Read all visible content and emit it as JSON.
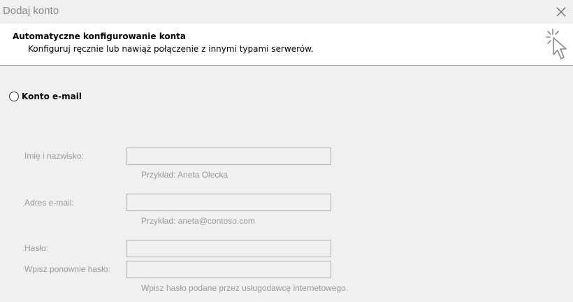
{
  "window": {
    "title": "Dodaj konto"
  },
  "header": {
    "title": "Automatyczne konfigurowanie konta",
    "subtitle": "Konfiguruj ręcznie lub nawiąż połączenie z innymi typami serwerów."
  },
  "email_account": {
    "radio_label": "Konto e-mail",
    "selected": false
  },
  "form": {
    "name_label": "Imię i nazwisko:",
    "name_value": "",
    "name_hint": "Przykład: Aneta Olecka",
    "email_label": "Adres e-mail:",
    "email_value": "",
    "email_hint": "Przykład: aneta@contoso.com",
    "password_label": "Hasło:",
    "password_value": "",
    "confirm_label": "Wpisz ponownie hasło:",
    "confirm_value": "",
    "password_hint": "Wpisz hasło podane przez usługodawcę internetowego."
  },
  "icons": {
    "close": "close-icon",
    "wizard": "cursor-sparkle-icon"
  },
  "colors": {
    "background": "#f0f0f0",
    "header_background": "#ffffff",
    "disabled_text": "#9a9a9a",
    "input_border": "#a7b4c3"
  }
}
